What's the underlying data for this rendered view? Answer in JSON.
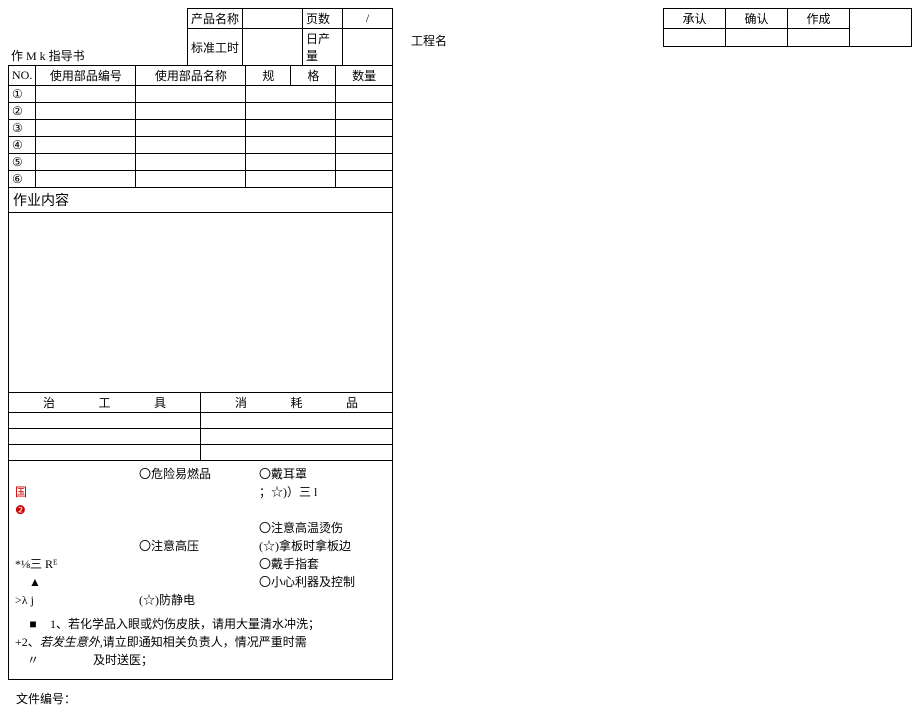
{
  "header": {
    "title": "作 M k 指导书",
    "prod_name_label": "产品名称",
    "std_time_label": "标准工时",
    "daily_output_label": "日产量",
    "pages_label": "页数",
    "pages_sep": "/",
    "eng_name_label": "工程名"
  },
  "parts": {
    "col_no": "NO.",
    "col_code": "使用部品编号",
    "col_name": "使用部品名称",
    "col_spec_a": "规",
    "col_spec_b": "格",
    "col_qty": "数量",
    "rows": [
      "①",
      "②",
      "③",
      "④",
      "⑤",
      "⑥"
    ]
  },
  "work": {
    "title": "作业内容"
  },
  "tools": {
    "zhi": "治",
    "gong": "工",
    "ju": "具",
    "xiao": "消",
    "hao": "耗",
    "pin": "品"
  },
  "safety": {
    "l1_r": "〇危险易燃品",
    "l1_d": "〇戴耳罩",
    "l2_a": "国",
    "l2_a2": "❷",
    "l2_d": "；☆)）三 l",
    "l3_d": "〇注意高温烫伤",
    "l4_c": "〇注意高压",
    "l4_d": "(☆)拿板时拿板边",
    "l5_a": "*⅛三 Rᴱ",
    "l5_d": "〇戴手指套",
    "l6_a": "▲",
    "l6_d": "〇小心利器及控制",
    "l7_a": ">λ j",
    "l7_c": "(☆)防静电",
    "note1_sym": "■",
    "note1": "1、若化学品入眼或灼伤皮肤，请用大量清水冲洗；",
    "note2_pre": "+2、",
    "note2_it": "若发生意外,",
    "note2_post": "请立即通知相关负责人，情况严重时需",
    "note3_q": "〃",
    "note3": "及时送医；"
  },
  "file_label": "文件编号：",
  "approval": {
    "c1": "承认",
    "c2": "确认",
    "c3": "作成"
  }
}
